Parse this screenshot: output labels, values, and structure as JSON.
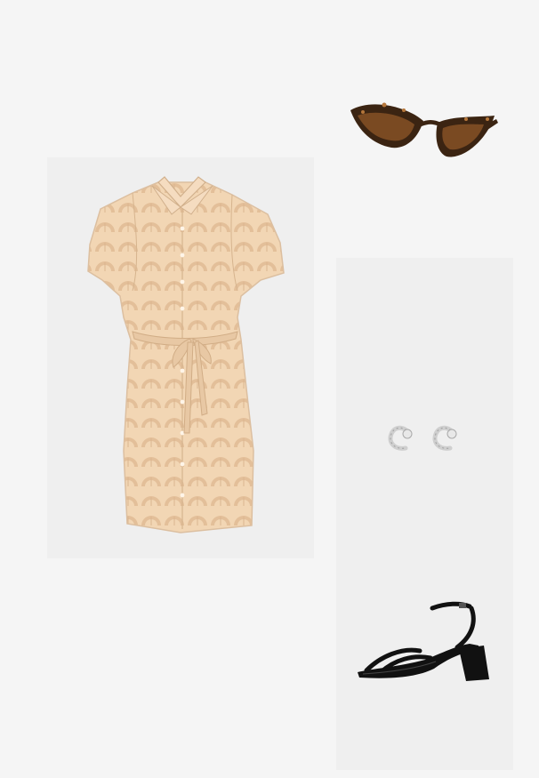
{
  "outfit": {
    "items": [
      {
        "icon": "sunglasses-icon",
        "lens_color": "#7a4a22",
        "frame_color": "#3b2412"
      },
      {
        "icon": "shirt-dress-icon",
        "fabric_color": "#f2d6b4",
        "print_color": "#dbb590"
      },
      {
        "icon": "stud-earrings-icon",
        "metal_color": "#cfcfcf"
      },
      {
        "icon": "block-heel-sandal-icon",
        "color": "#111111"
      }
    ]
  }
}
